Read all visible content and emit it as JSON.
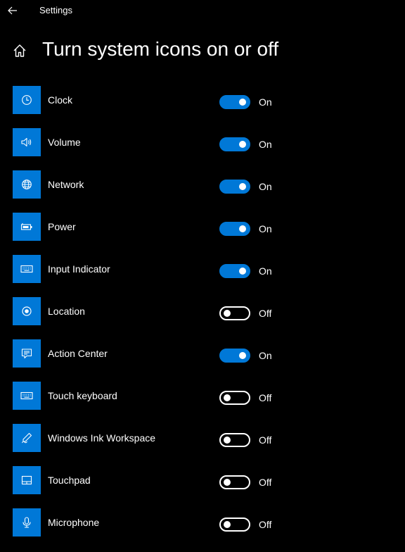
{
  "window": {
    "app_title": "Settings"
  },
  "header": {
    "page_title": "Turn system icons on or off"
  },
  "colors": {
    "accent": "#0078d7",
    "background": "#000000",
    "text": "#ffffff"
  },
  "items": [
    {
      "label": "Clock",
      "icon": "clock-icon",
      "state": "On"
    },
    {
      "label": "Volume",
      "icon": "volume-icon",
      "state": "On"
    },
    {
      "label": "Network",
      "icon": "globe-icon",
      "state": "On"
    },
    {
      "label": "Power",
      "icon": "battery-icon",
      "state": "On"
    },
    {
      "label": "Input Indicator",
      "icon": "keyboard-icon",
      "state": "On"
    },
    {
      "label": "Location",
      "icon": "location-icon",
      "state": "Off"
    },
    {
      "label": "Action Center",
      "icon": "action-center-icon",
      "state": "On"
    },
    {
      "label": "Touch keyboard",
      "icon": "keyboard-icon",
      "state": "Off"
    },
    {
      "label": "Windows Ink Workspace",
      "icon": "pen-icon",
      "state": "Off"
    },
    {
      "label": "Touchpad",
      "icon": "touchpad-icon",
      "state": "Off"
    },
    {
      "label": "Microphone",
      "icon": "microphone-icon",
      "state": "Off"
    }
  ]
}
